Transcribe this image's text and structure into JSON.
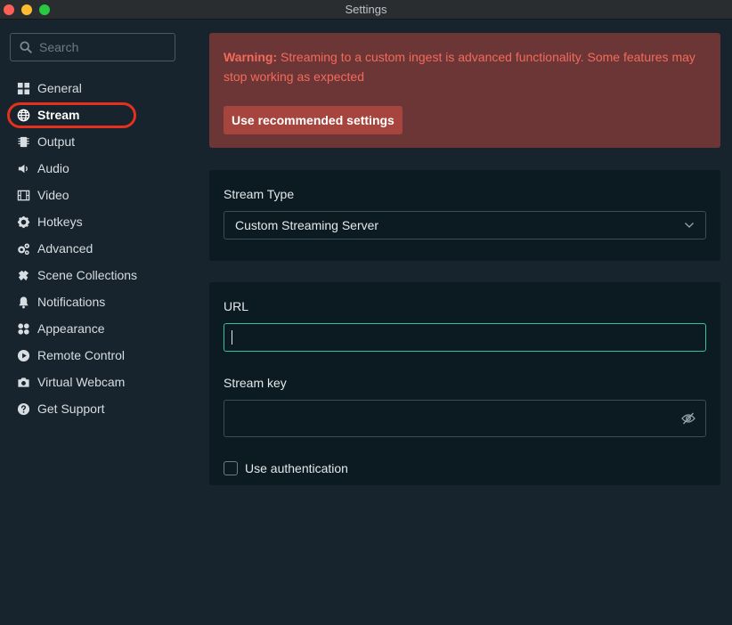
{
  "window": {
    "title": "Settings"
  },
  "search": {
    "placeholder": "Search"
  },
  "nav": {
    "items": [
      {
        "label": "General",
        "icon": "grid-icon"
      },
      {
        "label": "Stream",
        "icon": "globe-icon",
        "active": true
      },
      {
        "label": "Output",
        "icon": "chip-icon"
      },
      {
        "label": "Audio",
        "icon": "speaker-icon"
      },
      {
        "label": "Video",
        "icon": "film-icon"
      },
      {
        "label": "Hotkeys",
        "icon": "gear-icon"
      },
      {
        "label": "Advanced",
        "icon": "gears-icon"
      },
      {
        "label": "Scene Collections",
        "icon": "puzzle-icon"
      },
      {
        "label": "Notifications",
        "icon": "bell-icon"
      },
      {
        "label": "Appearance",
        "icon": "palette-icon"
      },
      {
        "label": "Remote Control",
        "icon": "play-circle-icon"
      },
      {
        "label": "Virtual Webcam",
        "icon": "camera-icon"
      },
      {
        "label": "Get Support",
        "icon": "question-icon"
      }
    ]
  },
  "warning": {
    "prefix": "Warning:",
    "message": " Streaming to a custom ingest is advanced functionality. Some features may stop working as expected",
    "button": "Use recommended settings"
  },
  "stream_type": {
    "label": "Stream Type",
    "value": "Custom Streaming Server"
  },
  "url": {
    "label": "URL",
    "value": ""
  },
  "stream_key": {
    "label": "Stream key",
    "value": ""
  },
  "auth": {
    "label": "Use authentication",
    "checked": false
  },
  "colors": {
    "background": "#17242d",
    "card": "#0c1a21",
    "warning_bg": "#6d3636",
    "warning_text": "#f26a5b",
    "focus_border": "#31c3a2",
    "highlight_ring": "#e4301d"
  }
}
